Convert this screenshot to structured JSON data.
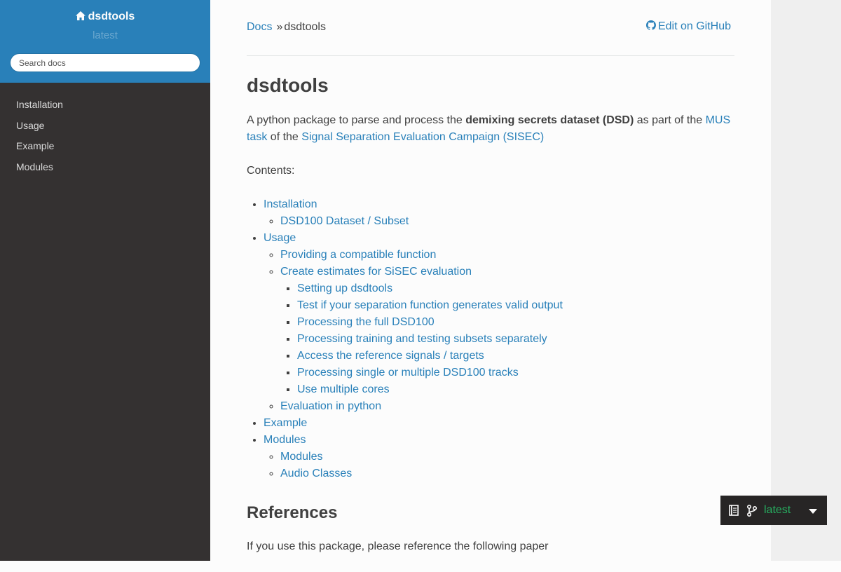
{
  "sidebar": {
    "project_name": "dsdtools",
    "version": "latest",
    "search_placeholder": "Search docs",
    "items": [
      {
        "label": "Installation"
      },
      {
        "label": "Usage"
      },
      {
        "label": "Example"
      },
      {
        "label": "Modules"
      }
    ]
  },
  "breadcrumb": {
    "root": "Docs",
    "separator": "»",
    "current": "dsdtools"
  },
  "edit_link": "Edit on GitHub",
  "page": {
    "title": "dsdtools",
    "intro": {
      "pre": "A python package to parse and process the ",
      "bold": "demixing secrets dataset (DSD)",
      "mid": " as part of the ",
      "link1": "MUS task",
      "mid2": " of the ",
      "link2": "Signal Separation Evaluation Campaign (SISEC)"
    },
    "contents_label": "Contents:",
    "toc": {
      "installation": "Installation",
      "dsd100": "DSD100 Dataset / Subset",
      "usage": "Usage",
      "providing": "Providing a compatible function",
      "create_estimates": "Create estimates for SiSEC evaluation",
      "setting_up": "Setting up dsdtools",
      "test_valid": "Test if your separation function generates valid output",
      "processing_full": "Processing the full DSD100",
      "processing_training": "Processing training and testing subsets separately",
      "access_reference": "Access the reference signals / targets",
      "processing_single": "Processing single or multiple DSD100 tracks",
      "multiple_cores": "Use multiple cores",
      "evaluation_python": "Evaluation in python",
      "example": "Example",
      "modules": "Modules",
      "modules_sub": "Modules",
      "audio_classes": "Audio Classes"
    },
    "references_title": "References",
    "references_text": "If you use this package, please reference the following paper"
  },
  "version_badge": {
    "version": "latest"
  }
}
